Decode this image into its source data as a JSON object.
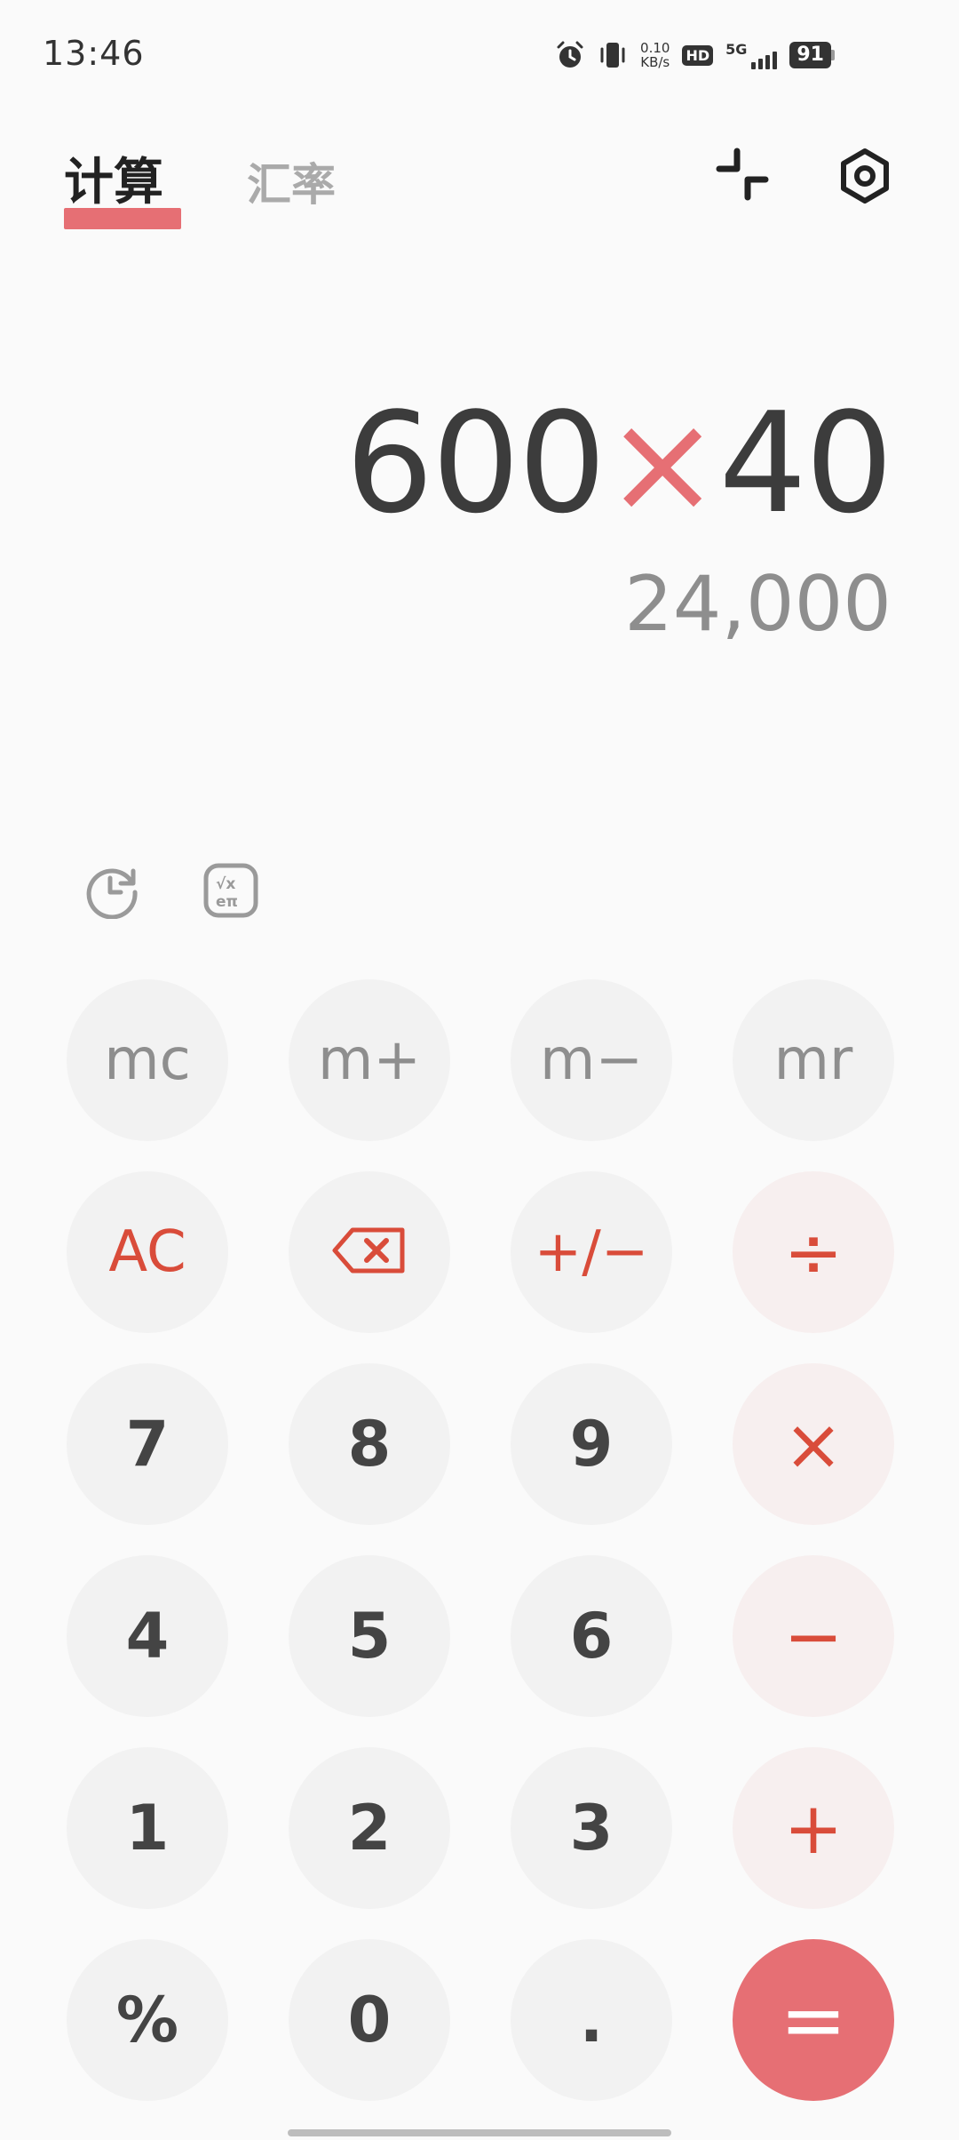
{
  "status_bar": {
    "time": "13:46",
    "net_speed_value": "0.10",
    "net_speed_unit": "KB/s",
    "hd": "HD",
    "network": "5G",
    "battery": "91"
  },
  "header": {
    "tabs": [
      {
        "label": "计算",
        "active": true
      },
      {
        "label": "汇率",
        "active": false
      }
    ],
    "icons": [
      "collapse-icon",
      "settings-icon"
    ]
  },
  "display": {
    "expression_left": "600",
    "expression_operator": "×",
    "expression_right": "40",
    "result": "24,000"
  },
  "tools": [
    "history-icon",
    "scientific-mode-icon"
  ],
  "keypad": {
    "mc": "mc",
    "m_plus": "m+",
    "m_minus": "m−",
    "mr": "mr",
    "ac": "AC",
    "plus_minus": "+/−",
    "divide": "÷",
    "seven": "7",
    "eight": "8",
    "nine": "9",
    "multiply": "×",
    "four": "4",
    "five": "5",
    "six": "6",
    "minus": "−",
    "one": "1",
    "two": "2",
    "three": "3",
    "plus": "+",
    "percent": "%",
    "zero": "0",
    "decimal": ".",
    "equals": "="
  },
  "colors": {
    "accent": "#e66f74",
    "operator_text": "#d94c3a",
    "key_bg": "#f2f2f2",
    "operator_key_bg": "#f7efef",
    "background": "#fafafa"
  }
}
